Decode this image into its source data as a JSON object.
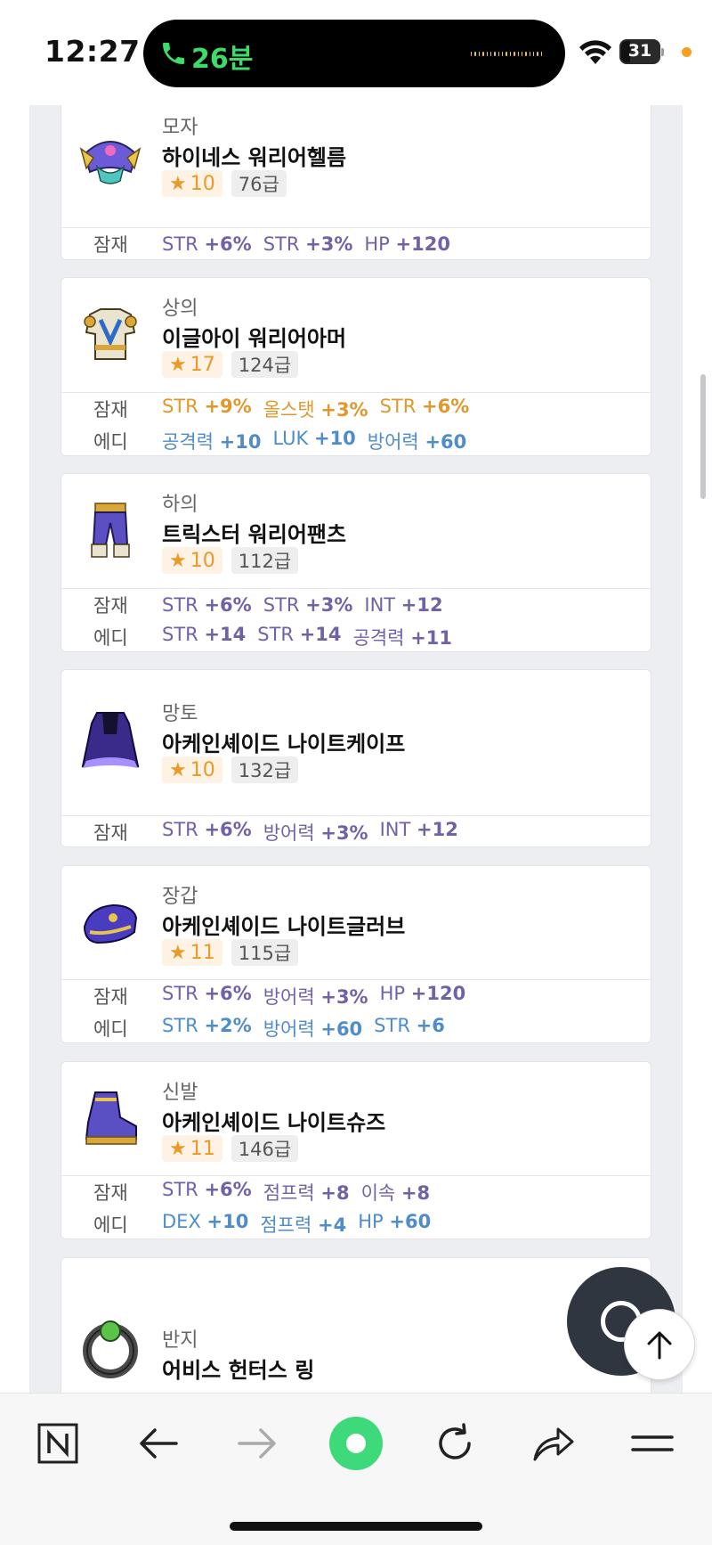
{
  "status_bar": {
    "time": "12:27",
    "call_duration": "26분",
    "battery": "31"
  },
  "items": [
    {
      "type": "모자",
      "name": "하이네스 워리어헬름",
      "star": "10",
      "level": "76급",
      "icon": "helmet-icon",
      "options": [
        {
          "label": "잠재",
          "color": "purple",
          "values": [
            [
              "STR",
              "+6%"
            ],
            [
              "STR",
              "+3%"
            ],
            [
              "HP",
              "+120"
            ]
          ]
        }
      ]
    },
    {
      "type": "상의",
      "name": "이글아이 워리어아머",
      "star": "17",
      "level": "124급",
      "icon": "armor-icon",
      "options": [
        {
          "label": "잠재",
          "color": "gold",
          "values": [
            [
              "STR",
              "+9%"
            ],
            [
              "올스탯",
              "+3%"
            ],
            [
              "STR",
              "+6%"
            ]
          ]
        },
        {
          "label": "에디",
          "color": "blue",
          "values": [
            [
              "공격력",
              "+10"
            ],
            [
              "LUK",
              "+10"
            ],
            [
              "방어력",
              "+60"
            ]
          ]
        }
      ]
    },
    {
      "type": "하의",
      "name": "트릭스터 워리어팬츠",
      "star": "10",
      "level": "112급",
      "icon": "pants-icon",
      "options": [
        {
          "label": "잠재",
          "color": "purple",
          "values": [
            [
              "STR",
              "+6%"
            ],
            [
              "STR",
              "+3%"
            ],
            [
              "INT",
              "+12"
            ]
          ]
        },
        {
          "label": "에디",
          "color": "purple",
          "values": [
            [
              "STR",
              "+14"
            ],
            [
              "STR",
              "+14"
            ],
            [
              "공격력",
              "+11"
            ]
          ]
        }
      ]
    },
    {
      "type": "망토",
      "name": "아케인셰이드 나이트케이프",
      "star": "10",
      "level": "132급",
      "icon": "cape-icon",
      "options": [
        {
          "label": "잠재",
          "color": "purple",
          "values": [
            [
              "STR",
              "+6%"
            ],
            [
              "방어력",
              "+3%"
            ],
            [
              "INT",
              "+12"
            ]
          ]
        }
      ]
    },
    {
      "type": "장갑",
      "name": "아케인셰이드 나이트글러브",
      "star": "11",
      "level": "115급",
      "icon": "glove-icon",
      "options": [
        {
          "label": "잠재",
          "color": "purple",
          "values": [
            [
              "STR",
              "+6%"
            ],
            [
              "방어력",
              "+3%"
            ],
            [
              "HP",
              "+120"
            ]
          ]
        },
        {
          "label": "에디",
          "color": "blue",
          "values": [
            [
              "STR",
              "+2%"
            ],
            [
              "방어력",
              "+60"
            ],
            [
              "STR",
              "+6"
            ]
          ]
        }
      ]
    },
    {
      "type": "신발",
      "name": "아케인셰이드 나이트슈즈",
      "star": "11",
      "level": "146급",
      "icon": "shoes-icon",
      "options": [
        {
          "label": "잠재",
          "color": "purple",
          "values": [
            [
              "STR",
              "+6%"
            ],
            [
              "점프력",
              "+8"
            ],
            [
              "이속",
              "+8"
            ]
          ]
        },
        {
          "label": "에디",
          "color": "blue",
          "values": [
            [
              "DEX",
              "+10"
            ],
            [
              "점프력",
              "+4"
            ],
            [
              "HP",
              "+60"
            ]
          ]
        }
      ]
    },
    {
      "type": "반지",
      "name": "어비스 헌터스 링",
      "icon": "ring-icon",
      "options": []
    }
  ],
  "bottom_nav": [
    "naver-home",
    "back",
    "forward",
    "green-dot",
    "reload",
    "share",
    "menu"
  ]
}
